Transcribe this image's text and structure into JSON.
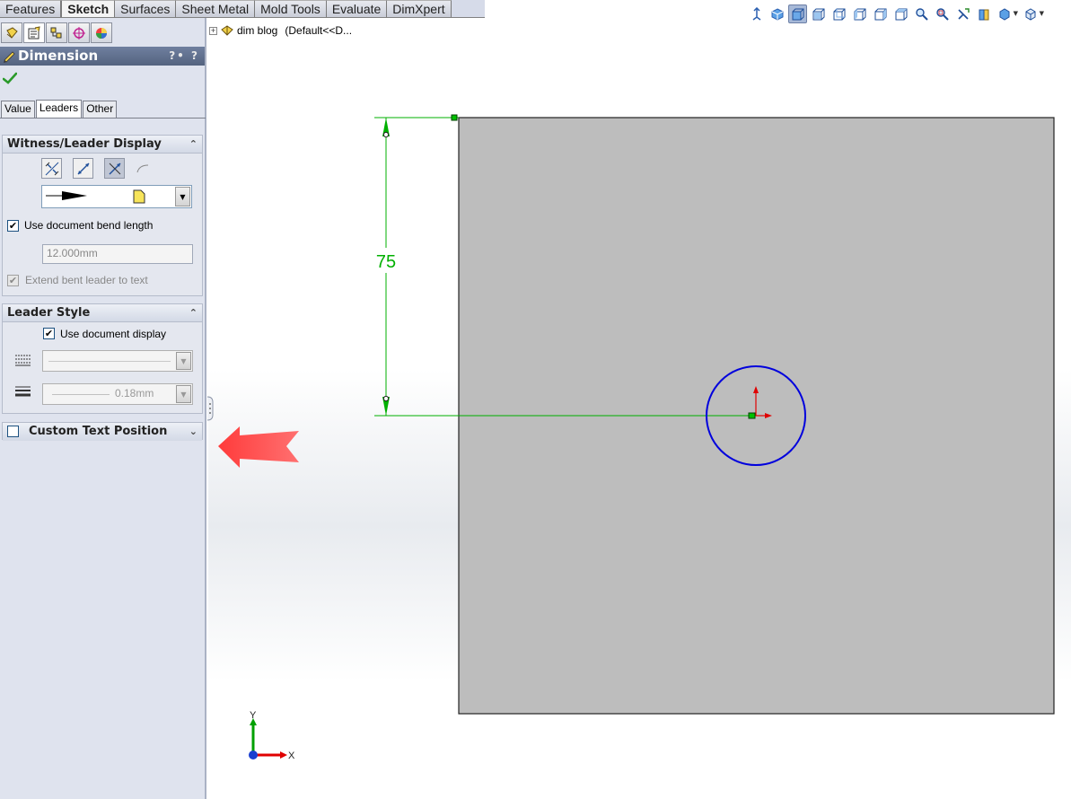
{
  "command_tabs": [
    "Features",
    "Sketch",
    "Surfaces",
    "Sheet Metal",
    "Mold Tools",
    "Evaluate",
    "DimXpert"
  ],
  "active_command_tab": "Sketch",
  "view_toolbar_icons": [
    "view-orientation-icon",
    "normal-to-icon",
    "isometric-icon",
    "front-view-icon",
    "back-view-icon",
    "left-view-icon",
    "right-view-icon",
    "top-view-icon",
    "zoom-to-fit-icon",
    "zoom-to-area-icon",
    "previous-view-icon",
    "section-view-icon",
    "display-style-icon",
    "hide-show-icon"
  ],
  "tree": {
    "document": "dim blog",
    "configuration": "(Default<<D..."
  },
  "panel": {
    "title": "Dimension",
    "help_marks": "?• ?",
    "tabs": [
      "Value",
      "Leaders",
      "Other"
    ],
    "active_tab": "Leaders",
    "witness": {
      "header": "Witness/Leader Display",
      "use_doc_bend_label": "Use document bend length",
      "use_doc_bend_checked": true,
      "bend_length": "12.000mm",
      "extend_bent_label": "Extend bent leader to text",
      "extend_bent_checked": true
    },
    "leader_style": {
      "header": "Leader Style",
      "use_doc_display_label": "Use document display",
      "use_doc_display_checked": true,
      "thickness_value": "0.18mm"
    },
    "custom_text": {
      "header": "Custom Text Position",
      "checked": false
    }
  },
  "drawing": {
    "dimension_value": "75",
    "colors": {
      "dimension": "#00b000",
      "circle": "#0000dd",
      "face": "#bdbdbd",
      "callout": "#f04040"
    }
  },
  "triad": {
    "x_label": "X",
    "y_label": "Y"
  }
}
